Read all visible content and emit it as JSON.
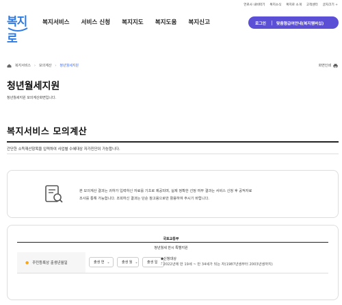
{
  "utility": [
    "언로사 내비따기",
    "복지소식",
    "복지로 소개",
    "고객센터",
    "글자크기 +"
  ],
  "logo": {
    "text": "복지로"
  },
  "nav": [
    "복지서비스",
    "서비스 신청",
    "복지지도",
    "복지도움",
    "복지신고"
  ],
  "login": {
    "login_label": "로그인",
    "custom_label": "맞춤형급여안내(복지멤버십)"
  },
  "breadcrumb": {
    "home": "복지서비스",
    "mid": "모의계산",
    "current": "청년월세지원"
  },
  "print_label": "화면인쇄",
  "page": {
    "title": "청년월세지원",
    "subtitle": "청년월세지원 모의계산화면입니다."
  },
  "section": {
    "title": "복지서비스 모의계산",
    "desc": "간단한 소득재산항목을 입력하여 사업별 수혜대상 자가진단이 가능합니다."
  },
  "info": {
    "line1": "본 모의계산 결과는 귀하가 입력하신 자료를 기초로 제공되며, 실제 정확한 선정 여부 결과는 서비스 신청 후 공적자료",
    "line2": "조사를 통해 가능합니다. 조회하신 결과는 단순 참고용으로만 활용하여 주시기 바랍니다."
  },
  "form": {
    "org": "국토교통부",
    "name": "청년월세 한시 특별지원",
    "row_label": "주민등록상 출생년월일",
    "selects": [
      "출생 연",
      "출생 월",
      "출생 일"
    ],
    "cond_title": "◆신청대상",
    "cond_detail": "- 2022년에 만 19세 ~ 만 34세가 되는 자(1987년생부터 2003년생까지)"
  },
  "colors": {
    "brand": "#5b4fd6",
    "logo_blue": "#2c7be5",
    "accent": "#f5a623",
    "link": "#3b6cf2"
  }
}
